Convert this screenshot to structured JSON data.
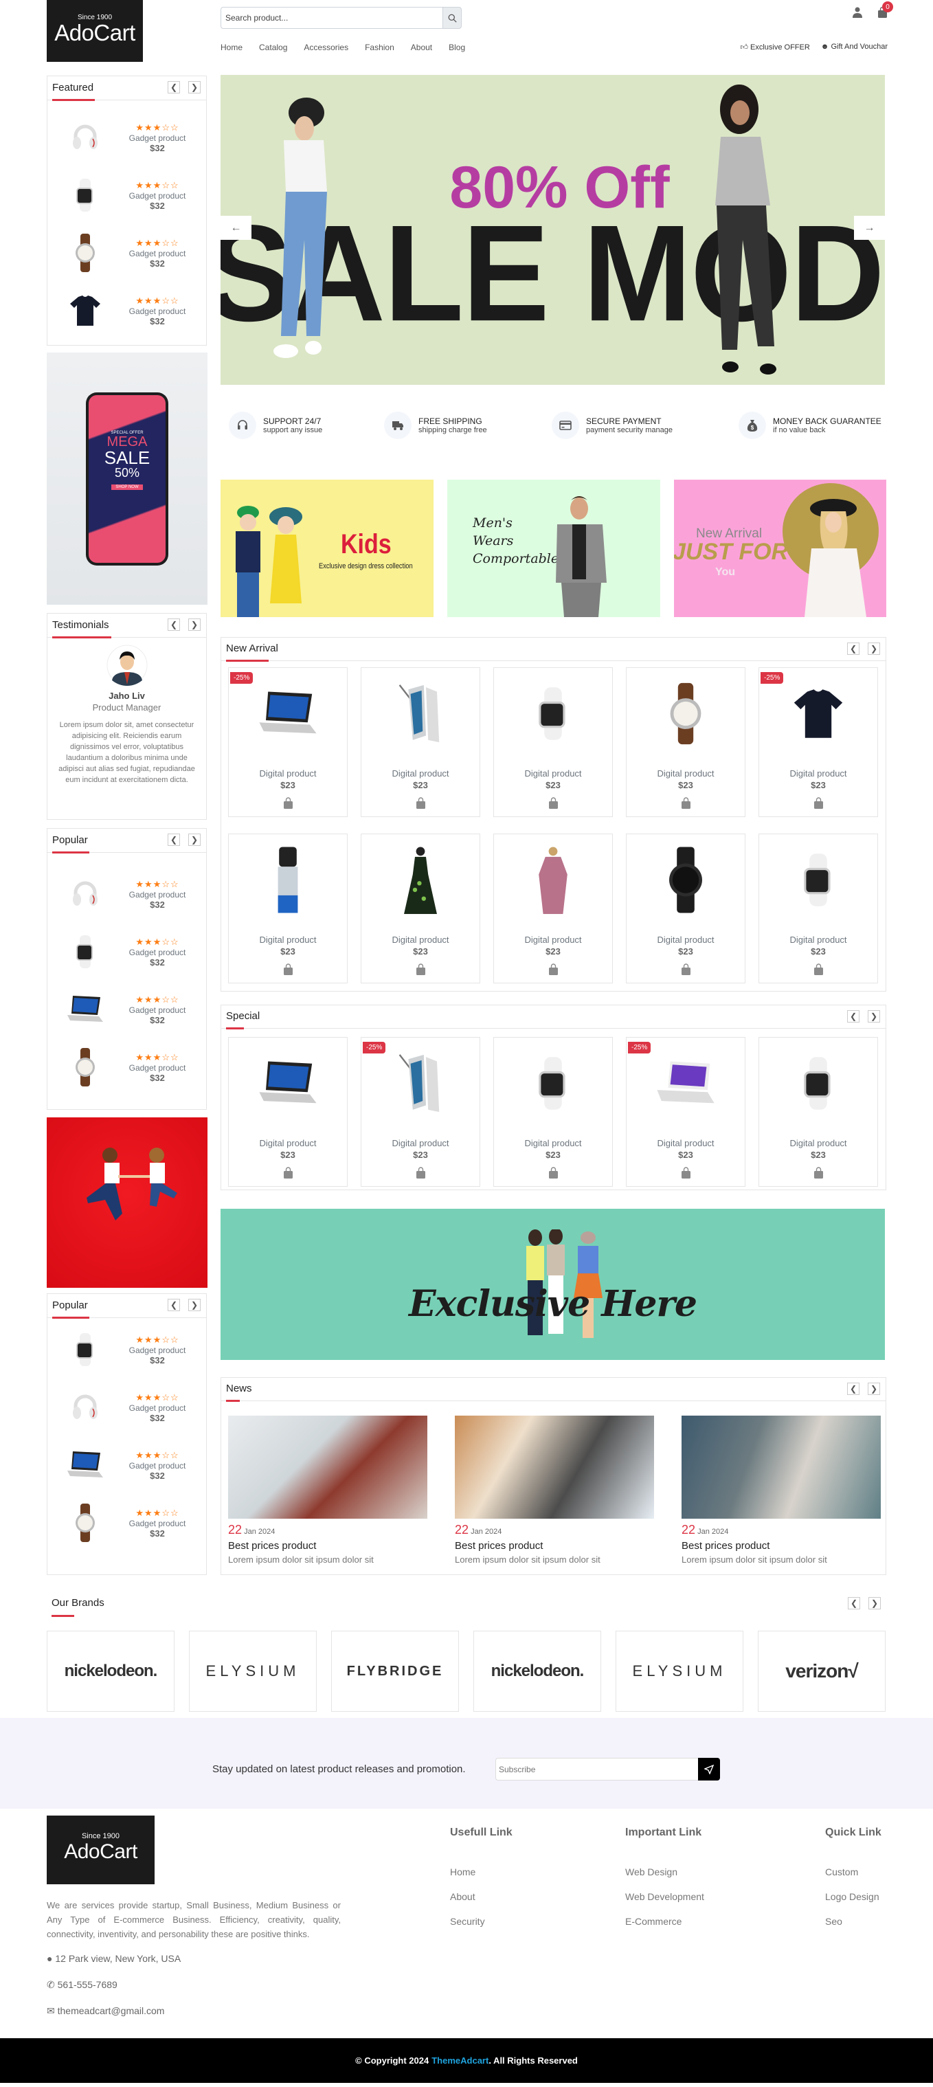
{
  "header": {
    "logo": {
      "since": "Since 1900",
      "name": "AdoCart"
    },
    "search": {
      "placeholder": "Search product..."
    },
    "nav": [
      "Home",
      "Catalog",
      "Accessories",
      "Fashion",
      "About",
      "Blog"
    ],
    "cart_count": "0",
    "offers": [
      {
        "icon": "thumbs-up-icon",
        "label": "Exclusive OFFER"
      },
      {
        "icon": "gift-icon",
        "label": "Gift And Vouchar"
      }
    ]
  },
  "hero": {
    "offer_text": "80% Off",
    "big_text": "SALE MODE",
    "bg_color": "#dbe6c6",
    "accent": "#b53da2"
  },
  "features": [
    {
      "title": "SUPPORT 24/7",
      "sub": "support any issue",
      "icon": "headset-icon"
    },
    {
      "title": "FREE SHIPPING",
      "sub": "shipping charge free",
      "icon": "truck-icon"
    },
    {
      "title": "SECURE PAYMENT",
      "sub": "payment security manage",
      "icon": "credit-card-icon"
    },
    {
      "title": "MONEY BACK GUARANTEE",
      "sub": "if no value back",
      "icon": "money-bag-icon"
    }
  ],
  "promo_banners": [
    {
      "title": "Kids",
      "sub": "Exclusive design dress collection",
      "bg": "#f9f192"
    },
    {
      "title": "Men's Wears Comportable",
      "bg": "#ddfde0"
    },
    {
      "title_small": "New Arrival",
      "title": "JUST FOR",
      "sub": "You",
      "bg": "#fba3d9"
    }
  ],
  "sidebar": {
    "featured": {
      "title": "Featured",
      "items": [
        {
          "img": "headphones",
          "rating": 3,
          "name": "Gadget product",
          "price": "$32"
        },
        {
          "img": "smartwatch",
          "rating": 3,
          "name": "Gadget product",
          "price": "$32"
        },
        {
          "img": "wristwatch",
          "rating": 3,
          "name": "Gadget product",
          "price": "$32"
        },
        {
          "img": "tshirt",
          "rating": 3,
          "name": "Gadget product",
          "price": "$32"
        }
      ]
    },
    "ad_phone": {
      "line1": "SPECIAL OFFER",
      "line2": "MEGA",
      "line3": "SALE",
      "line4": "50%",
      "cta": "SHOP NOW"
    },
    "testimonials": {
      "title": "Testimonials",
      "name": "Jaho Liv",
      "role": "Product Manager",
      "text": "Lorem ipsum dolor sit, amet consectetur adipisicing elit. Reiciendis earum dignissimos vel error, voluptatibus laudantium a doloribus minima unde adipisci aut alias sed fugiat, repudiandae eum incidunt at exercitationem dicta."
    },
    "popular1": {
      "title": "Popular",
      "items": [
        {
          "img": "headphones",
          "rating": 3,
          "name": "Gadget product",
          "price": "$32"
        },
        {
          "img": "smartwatch",
          "rating": 3,
          "name": "Gadget product",
          "price": "$32"
        },
        {
          "img": "laptop",
          "rating": 3,
          "name": "Gadget product",
          "price": "$32"
        },
        {
          "img": "wristwatch",
          "rating": 3,
          "name": "Gadget product",
          "price": "$32"
        }
      ]
    },
    "popular2": {
      "title": "Popular",
      "items": [
        {
          "img": "smartwatch",
          "rating": 3,
          "name": "Gadget product",
          "price": "$32"
        },
        {
          "img": "headphones",
          "rating": 3,
          "name": "Gadget product",
          "price": "$32"
        },
        {
          "img": "laptop",
          "rating": 3,
          "name": "Gadget product",
          "price": "$32"
        },
        {
          "img": "wristwatch",
          "rating": 3,
          "name": "Gadget product",
          "price": "$32"
        }
      ]
    }
  },
  "new_arrival": {
    "title": "New Arrival",
    "products": [
      {
        "img": "laptop",
        "name": "Digital product",
        "price": "$23",
        "discount": "-25%"
      },
      {
        "img": "phone",
        "name": "Digital product",
        "price": "$23",
        "discount": ""
      },
      {
        "img": "smartwatch",
        "name": "Digital product",
        "price": "$23",
        "discount": ""
      },
      {
        "img": "wristwatch",
        "name": "Digital product",
        "price": "$23",
        "discount": ""
      },
      {
        "img": "tshirt",
        "name": "Digital product",
        "price": "$23",
        "discount": "-25%"
      },
      {
        "img": "spray",
        "name": "Digital product",
        "price": "$23",
        "discount": ""
      },
      {
        "img": "dress-green",
        "name": "Digital product",
        "price": "$23",
        "discount": ""
      },
      {
        "img": "dress-pink",
        "name": "Digital product",
        "price": "$23",
        "discount": ""
      },
      {
        "img": "black-watch",
        "name": "Digital product",
        "price": "$23",
        "discount": ""
      },
      {
        "img": "smartwatch",
        "name": "Digital product",
        "price": "$23",
        "discount": ""
      }
    ]
  },
  "special": {
    "title": "Special",
    "products": [
      {
        "img": "laptop",
        "name": "Digital product",
        "price": "$23",
        "discount": ""
      },
      {
        "img": "phone",
        "name": "Digital product",
        "price": "$23",
        "discount": "-25%"
      },
      {
        "img": "smartwatch",
        "name": "Digital product",
        "price": "$23",
        "discount": ""
      },
      {
        "img": "laptop-white",
        "name": "Digital product",
        "price": "$23",
        "discount": "-25%"
      },
      {
        "img": "smartwatch",
        "name": "Digital product",
        "price": "$23",
        "discount": ""
      }
    ]
  },
  "exclusive_banner": {
    "text": "Exclusive Here",
    "bg": "#77d0b5"
  },
  "news": {
    "title": "News",
    "items": [
      {
        "day": "22",
        "month": "Jan 2024",
        "title": "Best prices product",
        "text": "Lorem ipsum dolor sit ipsum dolor sit"
      },
      {
        "day": "22",
        "month": "Jan 2024",
        "title": "Best prices product",
        "text": "Lorem ipsum dolor sit ipsum dolor sit"
      },
      {
        "day": "22",
        "month": "Jan 2024",
        "title": "Best prices product",
        "text": "Lorem ipsum dolor sit ipsum dolor sit"
      }
    ]
  },
  "brands": {
    "title": "Our Brands",
    "items": [
      "nickelodeon.",
      "ELYSIUM",
      "FLYBRIDGE",
      "nickelodeon.",
      "ELYSIUM",
      "verizon√"
    ]
  },
  "newsletter": {
    "text": "Stay updated on latest product releases and promotion.",
    "placeholder": "Subscribe"
  },
  "footer": {
    "about": "We are services provide startup, Small Business, Medium Business or Any Type of E-commerce Business. Efficiency, creativity, quality, connectivity, inventivity, and personability these are positive thinks.",
    "address": "12 Park view, New York, USA",
    "phone": "561-555-7689",
    "email": "themeadcart@gmail.com",
    "columns": [
      {
        "title": "Usefull Link",
        "links": [
          "Home",
          "About",
          "Security"
        ]
      },
      {
        "title": "Important Link",
        "links": [
          "Web Design",
          "Web Development",
          "E-Commerce"
        ]
      },
      {
        "title": "Quick Link",
        "links": [
          "Custom",
          "Logo Design",
          "Seo"
        ]
      }
    ],
    "copyright_pre": "© Copyright 2024 ",
    "copyright_brand": "ThemeAdcart",
    "copyright_post": ". All Rights Reserved",
    "brand_color": "#1fa3dd"
  }
}
